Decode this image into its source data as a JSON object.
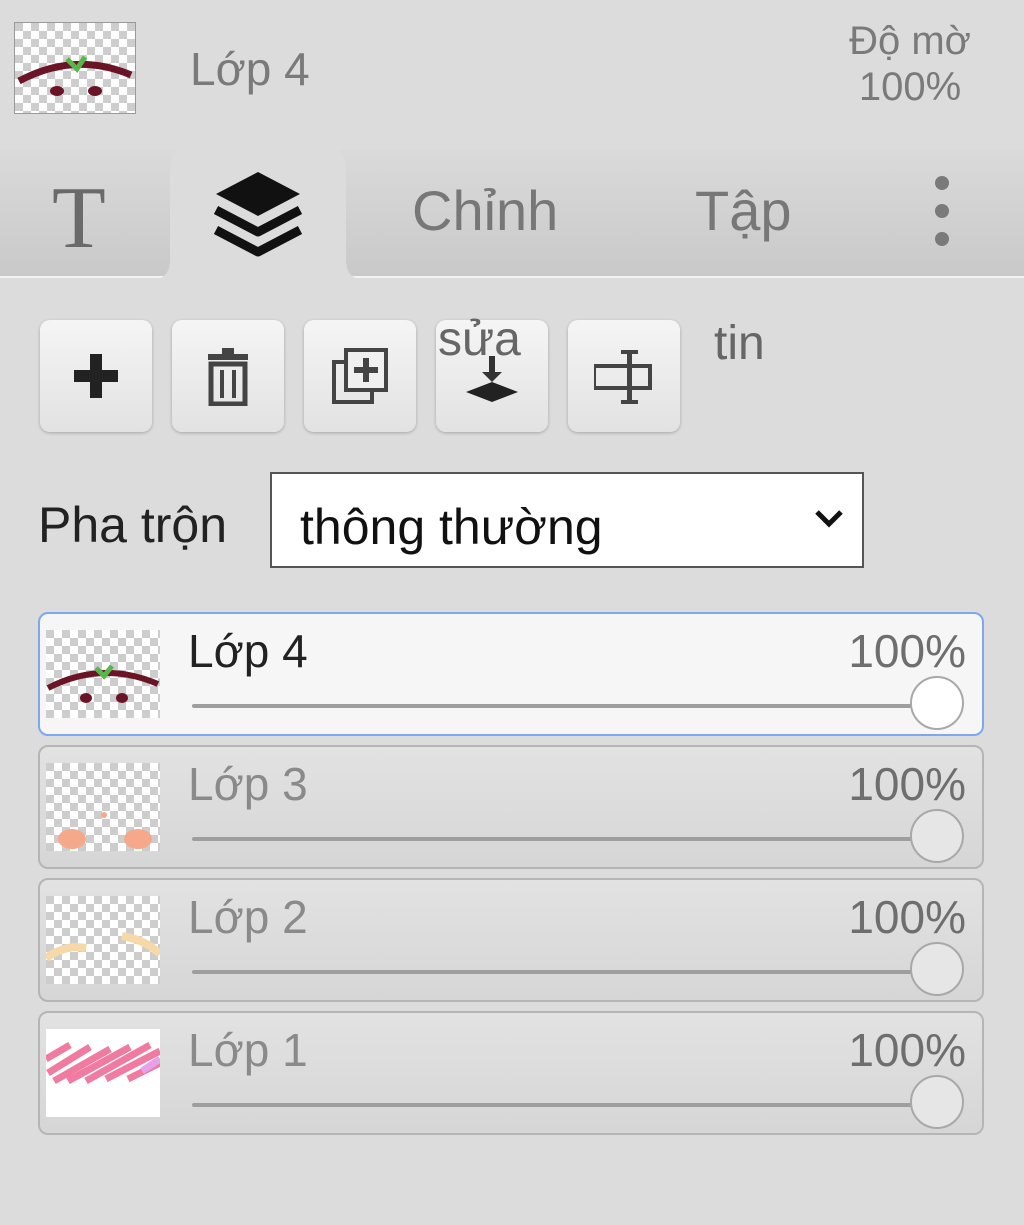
{
  "header": {
    "layer_name": "Lớp 4",
    "opacity_label": "Độ mờ",
    "opacity_value": "100%"
  },
  "tabs": [
    {
      "label": "T",
      "icon": "text-tool-icon"
    },
    {
      "label": "",
      "icon": "layers-icon",
      "active": true
    },
    {
      "label": "Chỉnh"
    },
    {
      "label": "Tập"
    },
    {
      "label": "",
      "icon": "more-vertical-icon"
    }
  ],
  "toolbar": {
    "buttons": [
      {
        "icon": "plus-icon"
      },
      {
        "icon": "trash-icon"
      },
      {
        "icon": "duplicate-icon"
      },
      {
        "icon": "merge-down-icon"
      },
      {
        "icon": "rename-icon"
      }
    ],
    "overlay_text_1": "sửa",
    "overlay_text_2": "tin"
  },
  "blend": {
    "label": "Pha trộn",
    "value": "thông thường"
  },
  "layers": [
    {
      "name": "Lớp 4",
      "opacity": "100%",
      "opacity_value": 1.0,
      "active": true
    },
    {
      "name": "Lớp 3",
      "opacity": "100%",
      "opacity_value": 1.0,
      "active": false
    },
    {
      "name": "Lớp 2",
      "opacity": "100%",
      "opacity_value": 1.0,
      "active": false
    },
    {
      "name": "Lớp 1",
      "opacity": "100%",
      "opacity_value": 1.0,
      "active": false
    }
  ],
  "colors": {
    "active_border": "#7da7ef",
    "panel_bg": "#dcdcdc",
    "stroke_dark_red": "#6b1426",
    "stroke_green": "#57b84a",
    "stroke_peach": "#f6a98a",
    "stroke_cream": "#f7d9a8",
    "stroke_pink": "#f07aa0"
  }
}
